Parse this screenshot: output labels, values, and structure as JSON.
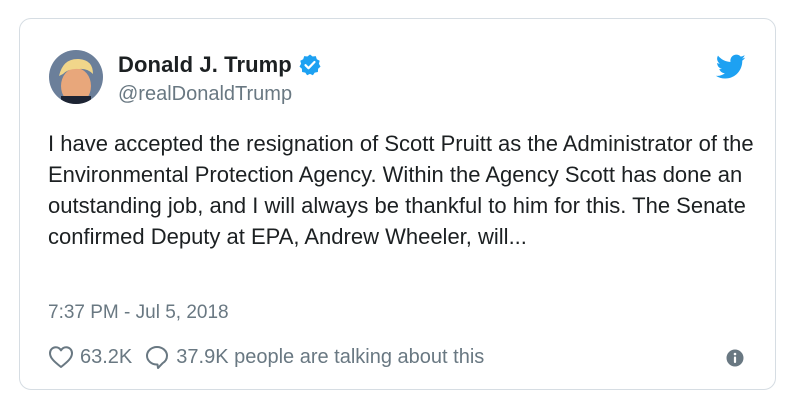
{
  "tweet": {
    "author_name": "Donald J. Trump",
    "handle": "@realDonaldTrump",
    "verified": true,
    "text": "I have accepted the resignation of Scott Pruitt as the Administrator of the Environmental Protection Agency. Within the Agency Scott has done an outstanding job, and I will always be thankful to him for this. The Senate confirmed Deputy at EPA, Andrew Wheeler, will...",
    "timestamp": "7:37 PM - Jul 5, 2018",
    "likes": "63.2K",
    "talking": "37.9K people are talking about this"
  },
  "icons": {
    "avatar": "avatar",
    "verified": "verified-badge-icon",
    "brand": "twitter-bird-icon",
    "like": "heart-icon",
    "reply": "speech-bubble-icon",
    "info": "info-icon"
  },
  "colors": {
    "brand": "#1da1f2",
    "muted": "#697882",
    "text": "#1c2022",
    "border": "#d6dde3"
  }
}
